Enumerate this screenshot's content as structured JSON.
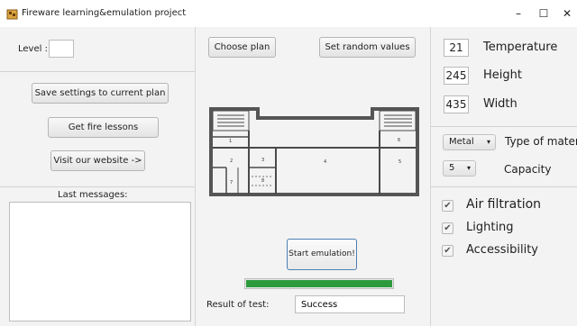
{
  "window": {
    "title": "Fireware learning&emulation project",
    "minimize_icon": "minimize-icon",
    "maximize_icon": "maximize-icon",
    "close_icon": "close-icon",
    "minimize_glyph": "–",
    "maximize_glyph": "☐",
    "close_glyph": "✕"
  },
  "left_panel": {
    "level_label": "Level :",
    "level_value": "",
    "save_button": "Save settings to current plan",
    "lessons_button": "Get fire lessons",
    "website_button": "Visit our website ->",
    "messages_label": "Last messages:",
    "messages_value": ""
  },
  "center_panel": {
    "choose_plan_button": "Choose plan",
    "random_values_button": "Set random  values",
    "floor_plan_rooms": [
      "1",
      "2",
      "3",
      "4",
      "5",
      "6",
      "7",
      "8"
    ],
    "start_button": "Start emulation!",
    "progress_fraction": 1.0,
    "progress_color": "#2e9a3e",
    "result_label": "Result of test:",
    "result_value": "Success"
  },
  "right_panel": {
    "temperature_value": "21",
    "temperature_label": "Temperature",
    "height_value": "245",
    "height_label": "Height",
    "width_value": "435",
    "width_label": "Width",
    "material_value": "Metal",
    "material_label": "Type of materia",
    "capacity_value": "5",
    "capacity_label": "Capacity",
    "air_filtration_label": "Air filtration",
    "air_filtration_checked": true,
    "lighting_label": "Lighting",
    "lighting_checked": true,
    "accessibility_label": "Accessibility",
    "accessibility_checked": true,
    "check_glyph": "✔",
    "dropdown_glyph": "▾"
  }
}
